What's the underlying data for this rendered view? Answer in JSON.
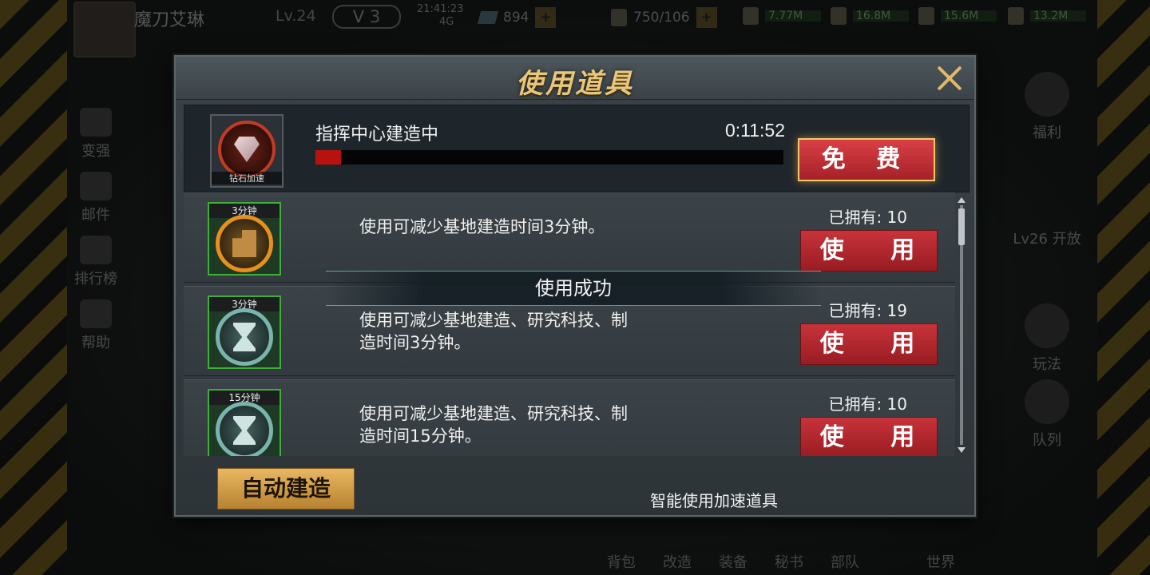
{
  "background": {
    "player": {
      "name": "魔刀艾琳",
      "level": "Lv.24",
      "vip": "V 3"
    },
    "status": {
      "time": "21:41:23",
      "network": "4G"
    },
    "resources": {
      "gems": "894",
      "energy": "750/106",
      "food": "7.77M",
      "oil": "16.8M",
      "steel": "15.6M",
      "power": "13.2M"
    },
    "side_left": [
      "变强",
      "邮件",
      "排行榜",
      "帮助"
    ],
    "side_right": [
      "福利",
      "Lv26 开放",
      "玩法",
      "队列"
    ],
    "bottom_nav": [
      "背包",
      "改造",
      "装备",
      "秘书",
      "部队",
      "世界"
    ]
  },
  "dialog": {
    "title": "使用道具",
    "current": {
      "icon_label": "钻石加速",
      "name": "指挥中心建造中",
      "time_left": "0:11:52",
      "progress": 0.055,
      "free_label": "免 费"
    },
    "items": [
      {
        "tag": "3分钟",
        "icon": "building-icon",
        "desc": "使用可减少基地建造时间3分钟。",
        "owned": "已拥有: 10",
        "use_label": "使 用"
      },
      {
        "tag": "3分钟",
        "icon": "hourglass-icon",
        "desc": "使用可减少基地建造、研究科技、制造时间3分钟。",
        "owned": "已拥有: 19",
        "use_label": "使 用"
      },
      {
        "tag": "15分钟",
        "icon": "hourglass-icon",
        "desc": "使用可减少基地建造、研究科技、制造时间15分钟。",
        "owned": "已拥有: 10",
        "use_label": "使 用"
      }
    ],
    "toast": "使用成功",
    "auto_build_label": "自动建造",
    "auto_build_hint": "智能使用加速道具"
  }
}
